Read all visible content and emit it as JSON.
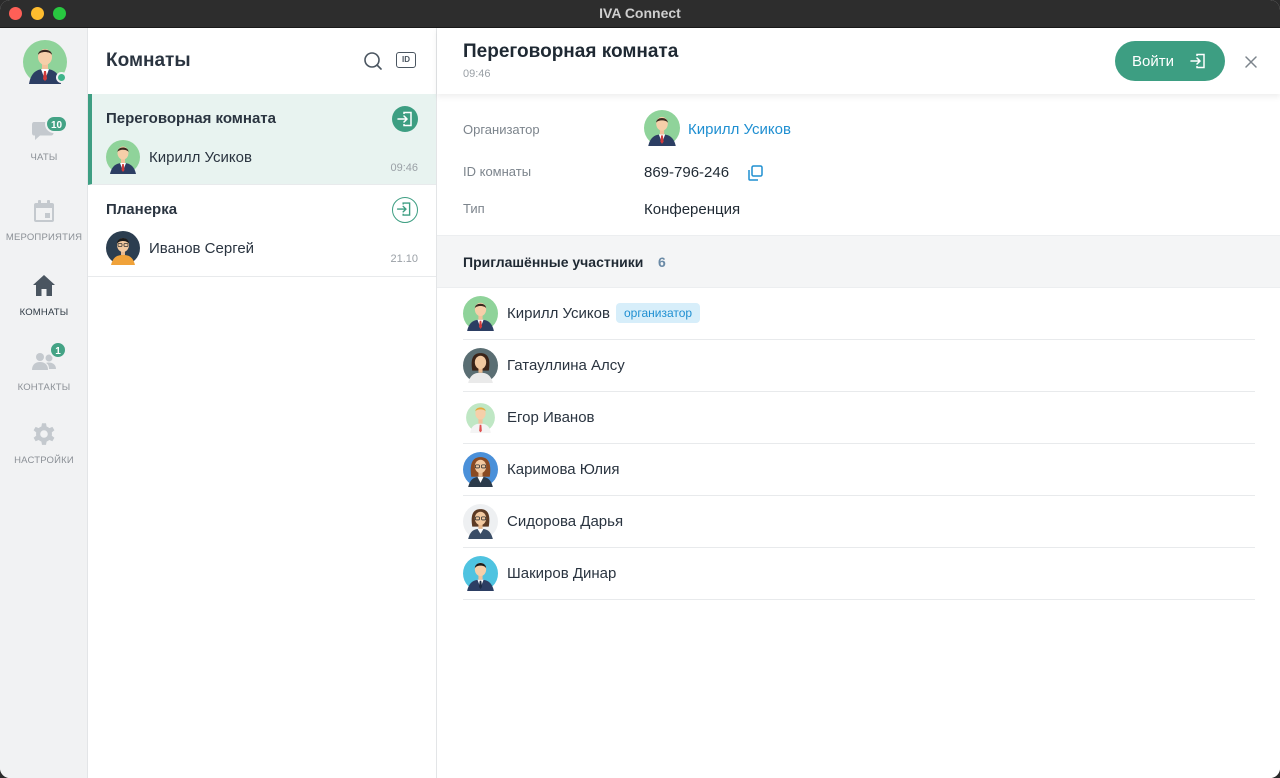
{
  "window": {
    "title": "IVA Connect"
  },
  "nav": {
    "items": [
      {
        "label": "ЧАТЫ",
        "badge": "10",
        "icon": "chat-icon"
      },
      {
        "label": "МЕРОПРИЯТИЯ",
        "badge": "",
        "icon": "calendar-icon"
      },
      {
        "label": "КОМНАТЫ",
        "badge": "",
        "icon": "home-icon",
        "active": true
      },
      {
        "label": "КОНТАКТЫ",
        "badge": "1",
        "icon": "contacts-icon"
      },
      {
        "label": "НАСТРОЙКИ",
        "badge": "",
        "icon": "gear-icon"
      }
    ]
  },
  "rooms": {
    "title": "Комнаты",
    "id_button": "ID",
    "list": [
      {
        "name": "Переговорная комната",
        "person": "Кирилл Усиков",
        "time": "09:46",
        "selected": true
      },
      {
        "name": "Планерка",
        "person": "Иванов Сергей",
        "time": "21.10",
        "selected": false
      }
    ]
  },
  "detail": {
    "title": "Переговорная комната",
    "time": "09:46",
    "join_label": "Войти",
    "organizer_label": "Организатор",
    "organizer_name": "Кирилл Усиков",
    "room_id_label": "ID комнаты",
    "room_id": "869-796-246",
    "type_label": "Тип",
    "type_value": "Конференция",
    "participants_title": "Приглашённые участники",
    "participants_count": "6",
    "organizer_tag": "организатор",
    "participants": [
      {
        "name": "Кирилл Усиков"
      },
      {
        "name": "Гатауллина Алсу"
      },
      {
        "name": "Егор Иванов"
      },
      {
        "name": "Каримова Юлия"
      },
      {
        "name": "Сидорова Дарья"
      },
      {
        "name": "Шакиров Динар"
      }
    ]
  },
  "colors": {
    "accent": "#3d9e82",
    "link": "#1f8fd1",
    "selected_bg": "#e8f3f0",
    "tag_bg": "#d7eefa"
  }
}
